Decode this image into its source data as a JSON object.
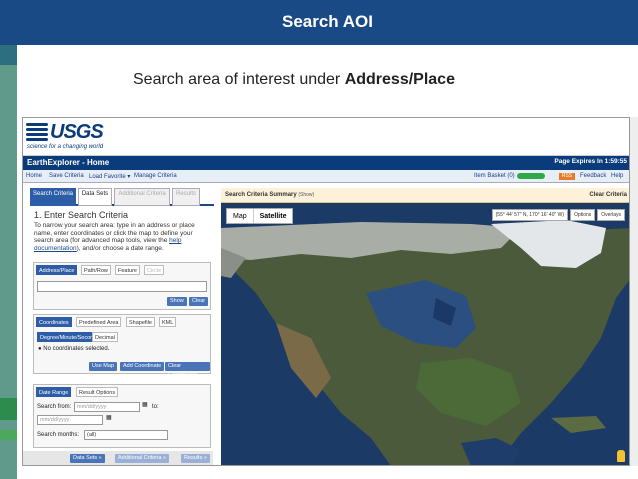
{
  "slide": {
    "title": "Search AOI",
    "subtitle_prefix": "Search area of interest under ",
    "subtitle_bold": "Address/Place"
  },
  "usgs": {
    "logo_text": "USGS",
    "tagline": "science for a changing world",
    "app_title": "EarthExplorer - Home",
    "expiry": "Page Expires In 1:59:55"
  },
  "nav": {
    "items": [
      "Home",
      "Save Criteria",
      "Load Favorite ▾",
      "Manage Criteria"
    ],
    "item_basket": "Item Basket (0)",
    "rss": "RSS",
    "feedback": "Feedback",
    "help": "Help"
  },
  "left_panel": {
    "tabs": [
      "Search Criteria",
      "Data Sets",
      "Additional Criteria",
      "Results"
    ],
    "heading": "1. Enter Search Criteria",
    "desc_before": "To narrow your search area: type in an address or place name, enter coordinates or click the map to define your search area (for advanced map tools, view the ",
    "desc_link": "help documentation",
    "desc_after": "), and/or choose a date range.",
    "search_tabs": [
      "Address/Place",
      "Path/Row",
      "Feature",
      "Circle"
    ],
    "show_btn": "Show",
    "clear_btn": "Clear",
    "coord_tabs": [
      "Coordinates",
      "Predefined Area",
      "Shapefile",
      "KML"
    ],
    "format_tabs": [
      "Degree/Minute/Second",
      "Decimal"
    ],
    "no_coords": "No coordinates selected.",
    "use_map": "Use Map",
    "add_coord": "Add Coordinate",
    "clear_coords": "Clear Coordinates",
    "date_tabs": [
      "Date Range",
      "Result Options"
    ],
    "search_from": "Search from:",
    "date_placeholder": "mm/dd/yyyy",
    "to": "to:",
    "search_months": "Search months:",
    "months_value": "(all)",
    "foot_buttons": [
      "Data Sets »",
      "Additional Criteria »",
      "Results »"
    ]
  },
  "map": {
    "summary_title": "Search Criteria Summary",
    "summary_show": "(Show)",
    "clear_criteria": "Clear Criteria",
    "map_type": [
      "Map",
      "Satellite"
    ],
    "coords": "(55° 44' 57\" N, 170° 16' 40\" W)",
    "options": "Options",
    "overlays": "Overlays"
  }
}
